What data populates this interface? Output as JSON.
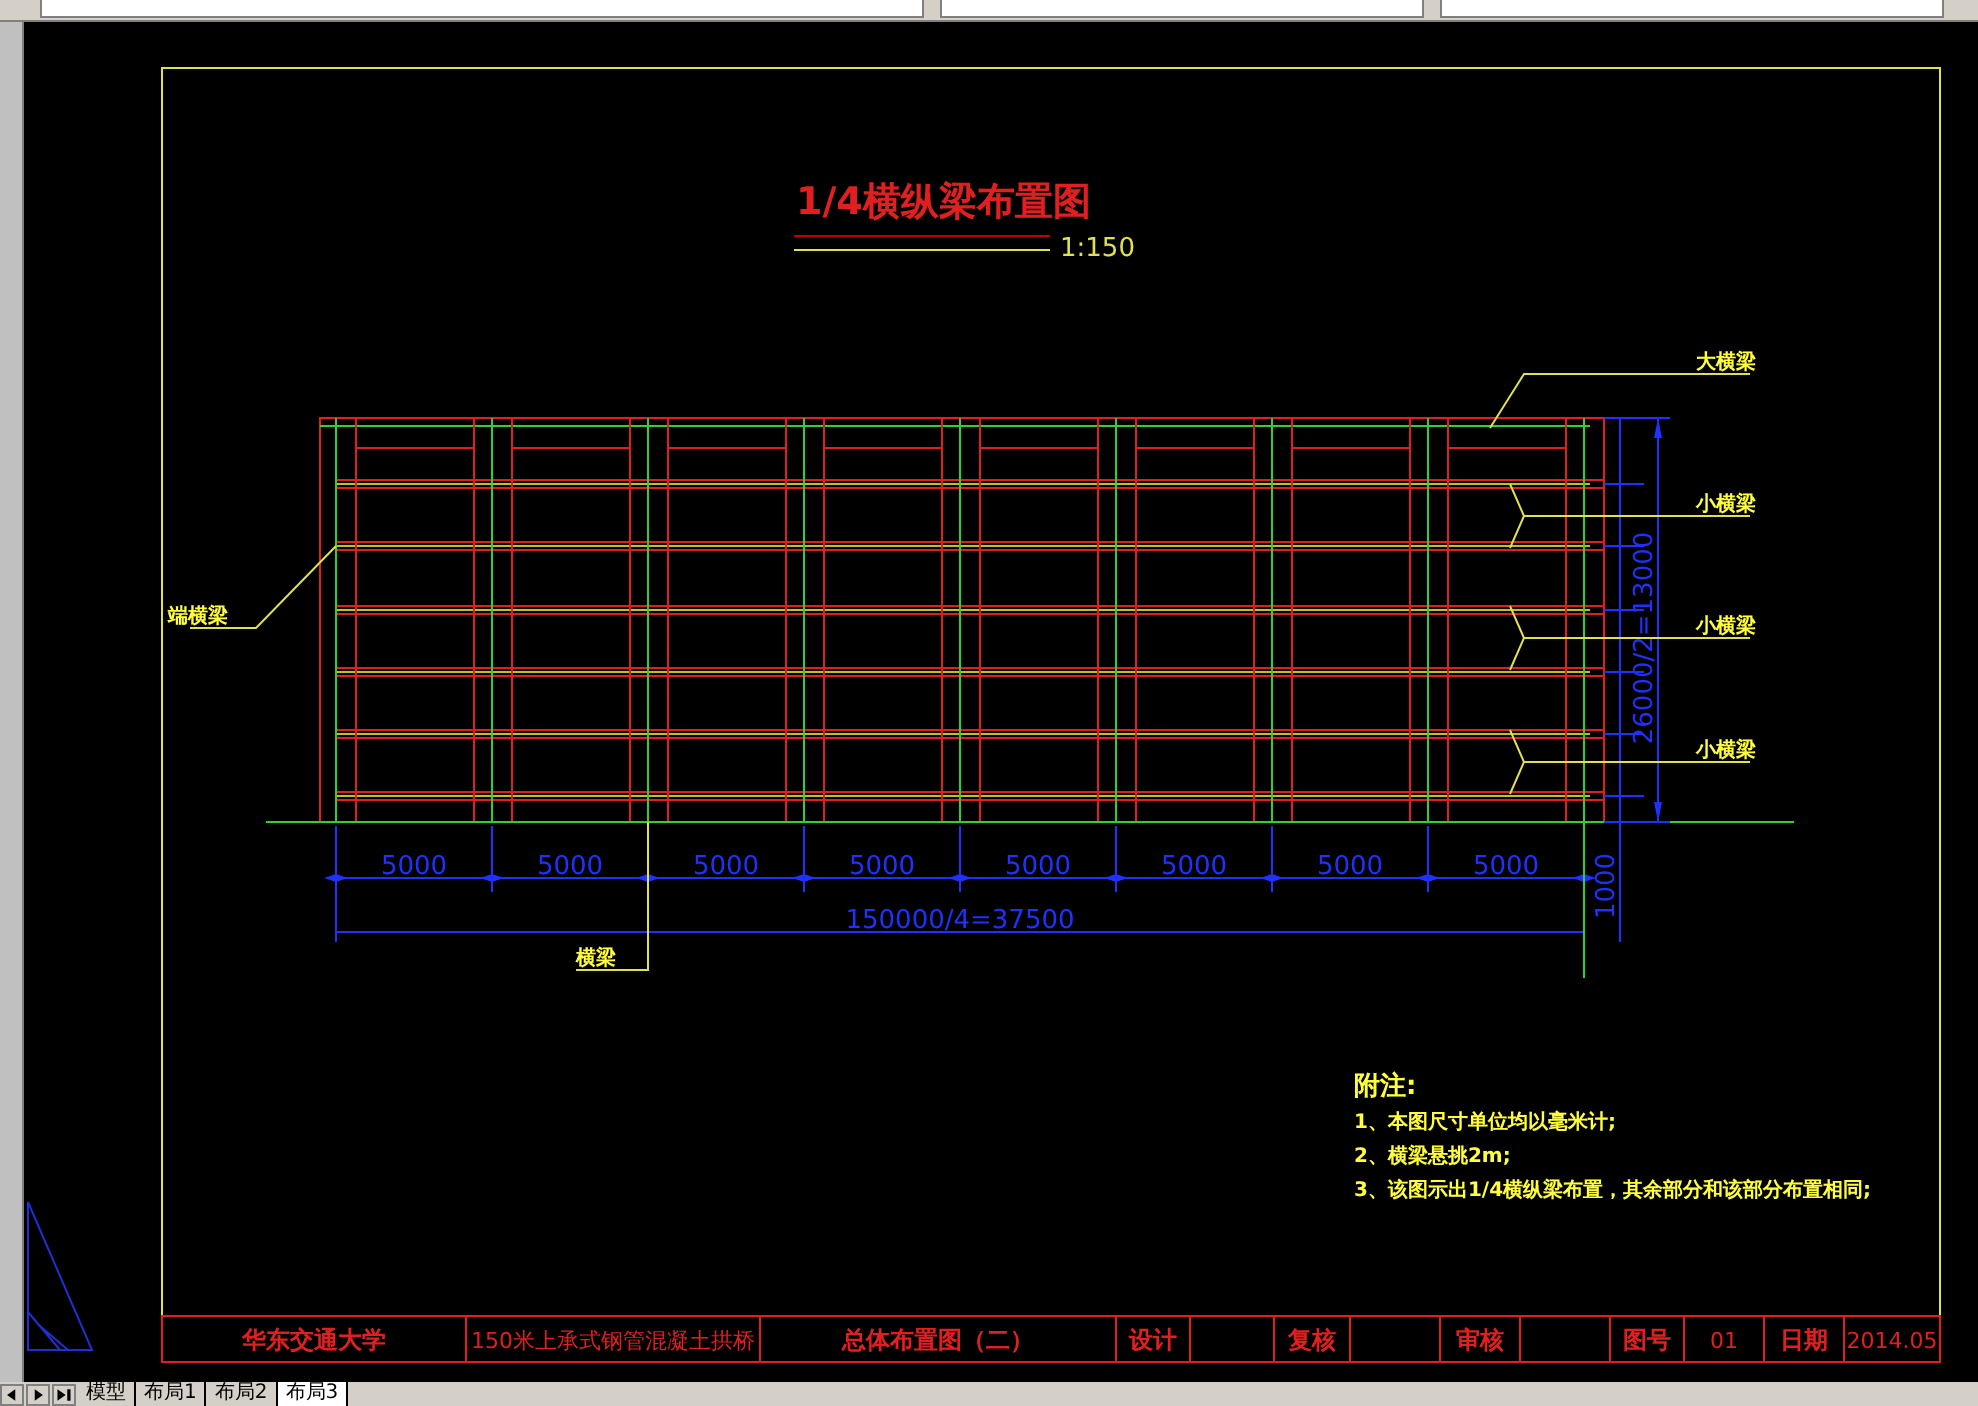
{
  "drawing": {
    "title": "1/4横纵梁布置图",
    "scale": "1:150",
    "span_dimensions": [
      "5000",
      "5000",
      "5000",
      "5000",
      "5000",
      "5000",
      "5000",
      "5000"
    ],
    "total_dimension": "150000/4=37500",
    "height_dimension": "26000/2=13000",
    "overhang_dimension": "1000",
    "callouts": [
      {
        "kind": "top",
        "text": "大横梁"
      },
      {
        "kind": "right",
        "text": "小横梁"
      },
      {
        "kind": "right",
        "text": "小横梁"
      },
      {
        "kind": "right",
        "text": "小横梁"
      },
      {
        "kind": "left",
        "text": "端横梁"
      },
      {
        "kind": "bottom",
        "text": "横梁"
      }
    ],
    "notes": {
      "heading": "附注:",
      "lines": [
        "1、本图尺寸单位均以毫米计;",
        "2、横梁悬挑2m;",
        "3、该图示出1/4横纵梁布置，其余部分和该部分布置相同;"
      ]
    }
  },
  "title_block": [
    {
      "kind": "text",
      "text": "华东交通大学"
    },
    {
      "kind": "text",
      "text": "150米上承式钢管混凝土拱桥"
    },
    {
      "kind": "text",
      "text": "总体布置图（二）"
    },
    {
      "kind": "text",
      "text": "设计"
    },
    {
      "kind": "blank"
    },
    {
      "kind": "text",
      "text": "复核"
    },
    {
      "kind": "blank"
    },
    {
      "kind": "text",
      "text": "审核"
    },
    {
      "kind": "blank"
    },
    {
      "kind": "text",
      "text": "图号"
    },
    {
      "kind": "text",
      "text": "01"
    },
    {
      "kind": "text",
      "text": "日期"
    },
    {
      "kind": "text",
      "text": "2014.05"
    }
  ],
  "tabs": [
    {
      "label": "模型",
      "selected": false
    },
    {
      "label": "布局1",
      "selected": false
    },
    {
      "label": "布局2",
      "selected": false
    },
    {
      "label": "布局3",
      "selected": true
    }
  ]
}
